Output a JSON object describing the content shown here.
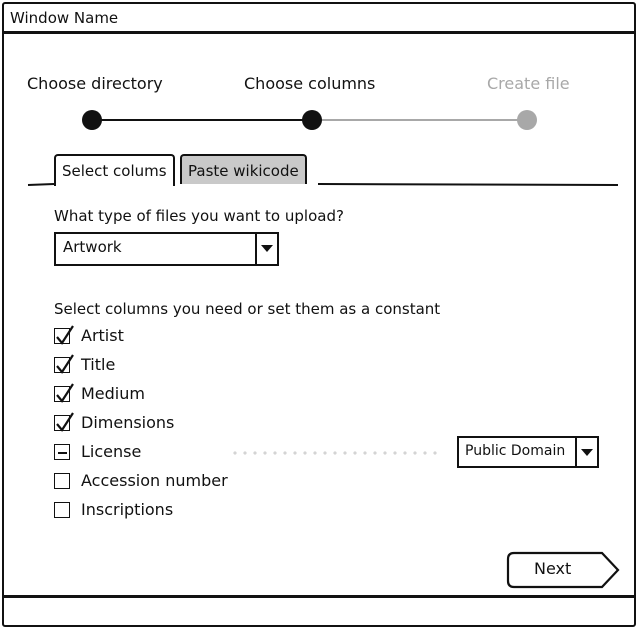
{
  "window": {
    "title": "Window Name"
  },
  "wizard": {
    "steps": [
      {
        "label": "Choose directory",
        "state": "done"
      },
      {
        "label": "Choose columns",
        "state": "current"
      },
      {
        "label": "Create file",
        "state": "pending"
      }
    ]
  },
  "tabs": [
    {
      "label": "Select colums",
      "selected": true
    },
    {
      "label": "Paste wikicode",
      "selected": false
    }
  ],
  "file_type": {
    "question": "What type of files you want to upload?",
    "selected": "Artwork"
  },
  "columns": {
    "heading": "Select columns you need or set them as a constant",
    "items": [
      {
        "label": "Artist",
        "state": "checked"
      },
      {
        "label": "Title",
        "state": "checked"
      },
      {
        "label": "Medium",
        "state": "checked"
      },
      {
        "label": "Dimensions",
        "state": "checked"
      },
      {
        "label": "License",
        "state": "indeterminate"
      },
      {
        "label": "Accession number",
        "state": "unchecked"
      },
      {
        "label": "Inscriptions",
        "state": "unchecked"
      }
    ],
    "license_constant": "Public Domain"
  },
  "footer": {
    "next_label": "Next"
  },
  "colors": {
    "line": "#111111",
    "inactive": "#a8a8a8",
    "tab_inactive": "#c9c9c9"
  }
}
